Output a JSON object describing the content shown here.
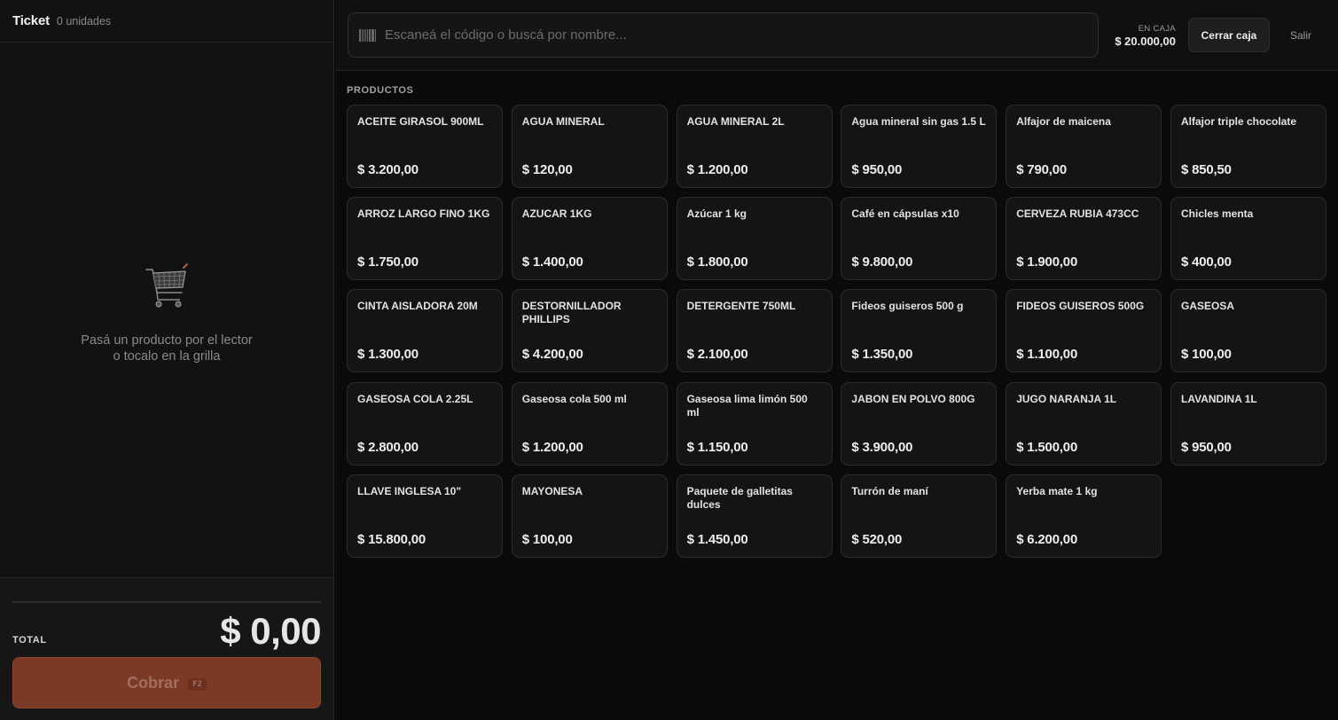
{
  "ticket": {
    "title": "Ticket",
    "units": "0 unidades",
    "empty_line1": "Pasá un producto por el lector",
    "empty_line2": "o tocalo en la grilla",
    "total_label": "TOTAL",
    "total_value": "$ 0,00",
    "charge_label": "Cobrar",
    "charge_shortcut": "F2",
    "cart_icon": "shopping-cart-icon"
  },
  "topbar": {
    "search_placeholder": "Escaneá el código o buscá por nombre...",
    "search_value": "",
    "search_icon": "barcode-icon",
    "cash_label": "EN CAJA",
    "cash_value": "$ 20.000,00",
    "close_register_label": "Cerrar caja",
    "logout_label": "Salir"
  },
  "products": {
    "section_label": "PRODUCTOS",
    "items": [
      {
        "name": "ACEITE GIRASOL 900ML",
        "price": "$ 3.200,00"
      },
      {
        "name": "AGUA MINERAL",
        "price": "$ 120,00"
      },
      {
        "name": "AGUA MINERAL 2L",
        "price": "$ 1.200,00"
      },
      {
        "name": "Agua mineral sin gas 1.5 L",
        "price": "$ 950,00"
      },
      {
        "name": "Alfajor de maicena",
        "price": "$ 790,00"
      },
      {
        "name": "Alfajor triple chocolate",
        "price": "$ 850,50"
      },
      {
        "name": "ARROZ LARGO FINO 1KG",
        "price": "$ 1.750,00"
      },
      {
        "name": "AZUCAR 1KG",
        "price": "$ 1.400,00"
      },
      {
        "name": "Azúcar 1 kg",
        "price": "$ 1.800,00"
      },
      {
        "name": "Café en cápsulas x10",
        "price": "$ 9.800,00"
      },
      {
        "name": "CERVEZA RUBIA 473CC",
        "price": "$ 1.900,00"
      },
      {
        "name": "Chicles menta",
        "price": "$ 400,00"
      },
      {
        "name": "CINTA AISLADORA 20M",
        "price": "$ 1.300,00"
      },
      {
        "name": "DESTORNILLADOR PHILLIPS",
        "price": "$ 4.200,00"
      },
      {
        "name": "DETERGENTE 750ML",
        "price": "$ 2.100,00"
      },
      {
        "name": "Fideos guiseros 500 g",
        "price": "$ 1.350,00"
      },
      {
        "name": "FIDEOS GUISEROS 500G",
        "price": "$ 1.100,00"
      },
      {
        "name": "GASEOSA",
        "price": "$ 100,00"
      },
      {
        "name": "GASEOSA COLA 2.25L",
        "price": "$ 2.800,00"
      },
      {
        "name": "Gaseosa cola 500 ml",
        "price": "$ 1.200,00"
      },
      {
        "name": "Gaseosa lima limón 500 ml",
        "price": "$ 1.150,00"
      },
      {
        "name": "JABON EN POLVO 800G",
        "price": "$ 3.900,00"
      },
      {
        "name": "JUGO NARANJA 1L",
        "price": "$ 1.500,00"
      },
      {
        "name": "LAVANDINA 1L",
        "price": "$ 950,00"
      },
      {
        "name": "LLAVE INGLESA 10\"",
        "price": "$ 15.800,00"
      },
      {
        "name": "MAYONESA",
        "price": "$ 100,00"
      },
      {
        "name": "Paquete de galletitas dulces",
        "price": "$ 1.450,00"
      },
      {
        "name": "Turrón de maní",
        "price": "$ 520,00"
      },
      {
        "name": "Yerba mate 1 kg",
        "price": "$ 6.200,00"
      }
    ]
  },
  "colors": {
    "background": "#0a0a0a",
    "panel": "#121212",
    "card": "#141414",
    "charge_button": "#7a3a25"
  }
}
